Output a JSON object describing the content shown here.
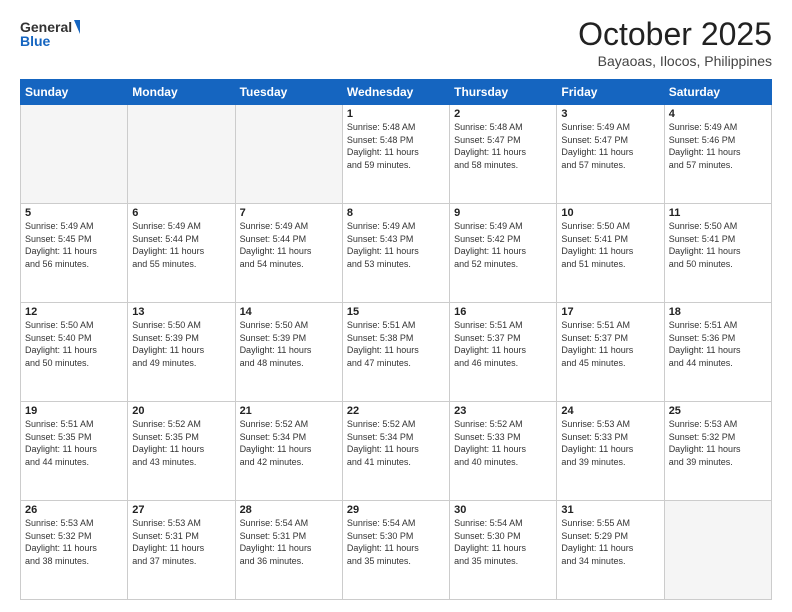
{
  "header": {
    "logo_line1": "General",
    "logo_line2": "Blue",
    "month": "October 2025",
    "location": "Bayaoas, Ilocos, Philippines"
  },
  "weekdays": [
    "Sunday",
    "Monday",
    "Tuesday",
    "Wednesday",
    "Thursday",
    "Friday",
    "Saturday"
  ],
  "weeks": [
    [
      {
        "day": "",
        "info": ""
      },
      {
        "day": "",
        "info": ""
      },
      {
        "day": "",
        "info": ""
      },
      {
        "day": "1",
        "info": "Sunrise: 5:48 AM\nSunset: 5:48 PM\nDaylight: 11 hours\nand 59 minutes."
      },
      {
        "day": "2",
        "info": "Sunrise: 5:48 AM\nSunset: 5:47 PM\nDaylight: 11 hours\nand 58 minutes."
      },
      {
        "day": "3",
        "info": "Sunrise: 5:49 AM\nSunset: 5:47 PM\nDaylight: 11 hours\nand 57 minutes."
      },
      {
        "day": "4",
        "info": "Sunrise: 5:49 AM\nSunset: 5:46 PM\nDaylight: 11 hours\nand 57 minutes."
      }
    ],
    [
      {
        "day": "5",
        "info": "Sunrise: 5:49 AM\nSunset: 5:45 PM\nDaylight: 11 hours\nand 56 minutes."
      },
      {
        "day": "6",
        "info": "Sunrise: 5:49 AM\nSunset: 5:44 PM\nDaylight: 11 hours\nand 55 minutes."
      },
      {
        "day": "7",
        "info": "Sunrise: 5:49 AM\nSunset: 5:44 PM\nDaylight: 11 hours\nand 54 minutes."
      },
      {
        "day": "8",
        "info": "Sunrise: 5:49 AM\nSunset: 5:43 PM\nDaylight: 11 hours\nand 53 minutes."
      },
      {
        "day": "9",
        "info": "Sunrise: 5:49 AM\nSunset: 5:42 PM\nDaylight: 11 hours\nand 52 minutes."
      },
      {
        "day": "10",
        "info": "Sunrise: 5:50 AM\nSunset: 5:41 PM\nDaylight: 11 hours\nand 51 minutes."
      },
      {
        "day": "11",
        "info": "Sunrise: 5:50 AM\nSunset: 5:41 PM\nDaylight: 11 hours\nand 50 minutes."
      }
    ],
    [
      {
        "day": "12",
        "info": "Sunrise: 5:50 AM\nSunset: 5:40 PM\nDaylight: 11 hours\nand 50 minutes."
      },
      {
        "day": "13",
        "info": "Sunrise: 5:50 AM\nSunset: 5:39 PM\nDaylight: 11 hours\nand 49 minutes."
      },
      {
        "day": "14",
        "info": "Sunrise: 5:50 AM\nSunset: 5:39 PM\nDaylight: 11 hours\nand 48 minutes."
      },
      {
        "day": "15",
        "info": "Sunrise: 5:51 AM\nSunset: 5:38 PM\nDaylight: 11 hours\nand 47 minutes."
      },
      {
        "day": "16",
        "info": "Sunrise: 5:51 AM\nSunset: 5:37 PM\nDaylight: 11 hours\nand 46 minutes."
      },
      {
        "day": "17",
        "info": "Sunrise: 5:51 AM\nSunset: 5:37 PM\nDaylight: 11 hours\nand 45 minutes."
      },
      {
        "day": "18",
        "info": "Sunrise: 5:51 AM\nSunset: 5:36 PM\nDaylight: 11 hours\nand 44 minutes."
      }
    ],
    [
      {
        "day": "19",
        "info": "Sunrise: 5:51 AM\nSunset: 5:35 PM\nDaylight: 11 hours\nand 44 minutes."
      },
      {
        "day": "20",
        "info": "Sunrise: 5:52 AM\nSunset: 5:35 PM\nDaylight: 11 hours\nand 43 minutes."
      },
      {
        "day": "21",
        "info": "Sunrise: 5:52 AM\nSunset: 5:34 PM\nDaylight: 11 hours\nand 42 minutes."
      },
      {
        "day": "22",
        "info": "Sunrise: 5:52 AM\nSunset: 5:34 PM\nDaylight: 11 hours\nand 41 minutes."
      },
      {
        "day": "23",
        "info": "Sunrise: 5:52 AM\nSunset: 5:33 PM\nDaylight: 11 hours\nand 40 minutes."
      },
      {
        "day": "24",
        "info": "Sunrise: 5:53 AM\nSunset: 5:33 PM\nDaylight: 11 hours\nand 39 minutes."
      },
      {
        "day": "25",
        "info": "Sunrise: 5:53 AM\nSunset: 5:32 PM\nDaylight: 11 hours\nand 39 minutes."
      }
    ],
    [
      {
        "day": "26",
        "info": "Sunrise: 5:53 AM\nSunset: 5:32 PM\nDaylight: 11 hours\nand 38 minutes."
      },
      {
        "day": "27",
        "info": "Sunrise: 5:53 AM\nSunset: 5:31 PM\nDaylight: 11 hours\nand 37 minutes."
      },
      {
        "day": "28",
        "info": "Sunrise: 5:54 AM\nSunset: 5:31 PM\nDaylight: 11 hours\nand 36 minutes."
      },
      {
        "day": "29",
        "info": "Sunrise: 5:54 AM\nSunset: 5:30 PM\nDaylight: 11 hours\nand 35 minutes."
      },
      {
        "day": "30",
        "info": "Sunrise: 5:54 AM\nSunset: 5:30 PM\nDaylight: 11 hours\nand 35 minutes."
      },
      {
        "day": "31",
        "info": "Sunrise: 5:55 AM\nSunset: 5:29 PM\nDaylight: 11 hours\nand 34 minutes."
      },
      {
        "day": "",
        "info": ""
      }
    ]
  ]
}
